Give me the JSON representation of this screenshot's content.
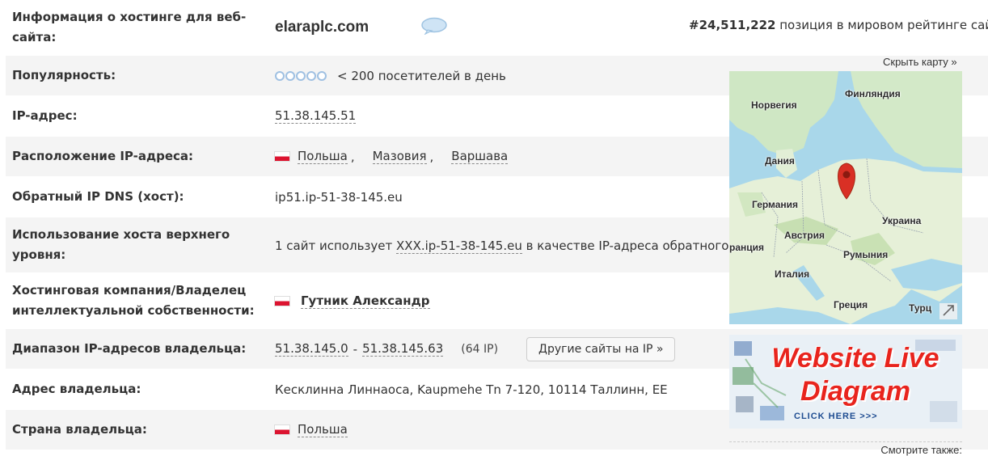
{
  "header_row": {
    "label": "Информация о хостинге для веб-сайта:",
    "domain": "elaraplc.com",
    "rank_value": "#24,511,222",
    "rank_text": "позиция в мировом рейтинге сай"
  },
  "rows": {
    "popularity": {
      "label": "Популярность:",
      "value": "< 200 посетителей в день"
    },
    "ip": {
      "label": "IP-адрес:",
      "value": "51.38.145.51"
    },
    "location": {
      "label": "Расположение IP-адреса:",
      "country": "Польша",
      "region": "Мазовия",
      "city": "Варшава"
    },
    "reverse_dns": {
      "label": "Обратный IP DNS (хост):",
      "value": "ip51.ip-51-38-145.eu"
    },
    "top_host": {
      "label": "Использование хоста верхнего уровня:",
      "prefix": "1 сайт использует",
      "link": "XXX.ip-51-38-145.eu",
      "suffix": "в качестве IP-адреса обратного"
    },
    "hosting_company": {
      "label": "Хостинговая компания/Владелец интеллектуальной собственности:",
      "value": "Гутник Александр"
    },
    "ip_range": {
      "label": "Диапазон IP-адресов владельца:",
      "start": "51.38.145.0",
      "dash": "-",
      "end": "51.38.145.63",
      "count": "(64 IP)",
      "button": "Другие сайты на IP »"
    },
    "owner_address": {
      "label": "Адрес владельца:",
      "value": "Кесклинна Линнаоса, Kaupmehe Tn 7-120, 10114 Таллинн, EE"
    },
    "owner_country": {
      "label": "Страна владельца:",
      "value": "Польша"
    }
  },
  "side": {
    "hide_map": "Скрыть карту »",
    "map_labels": {
      "norway": "Норвегия",
      "finland": "Финляндия",
      "denmark": "Дания",
      "germany": "Германия",
      "ukraine": "Украина",
      "austria": "Австрия",
      "france": "ранция",
      "romania": "Румыния",
      "italy": "Италия",
      "greece": "Греция",
      "turkey": "Турц"
    },
    "ad_line1": "Website Live",
    "ad_line2": "Diagram",
    "ad_click": "CLICK HERE >>>",
    "see_also": "Смотрите также:"
  },
  "colors": {
    "flag_red": "#dc1430",
    "pin": "#d93025",
    "ad_red": "#e8241d",
    "row_alt": "#f4f4f4"
  },
  "icons": [
    "speech-bubble-icon",
    "popularity-dots-icon",
    "poland-flag-icon",
    "map-pin-icon",
    "expand-map-icon"
  ]
}
